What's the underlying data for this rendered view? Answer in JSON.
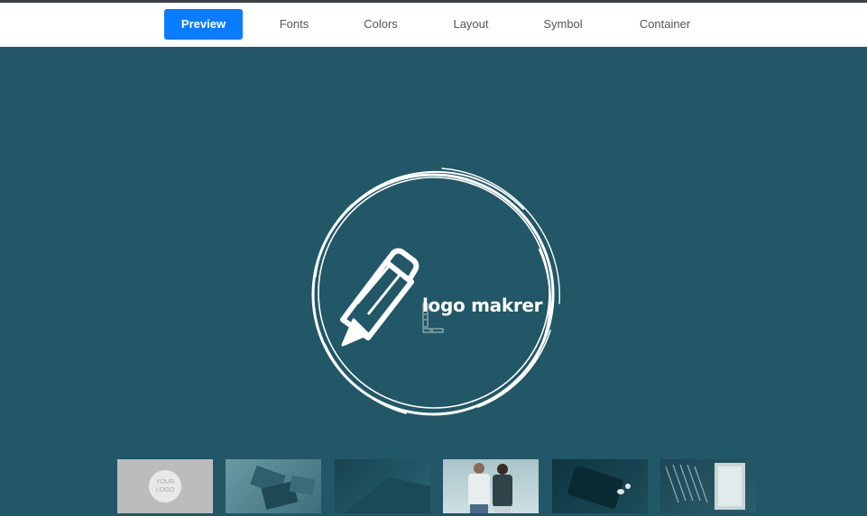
{
  "nav": {
    "tabs": [
      {
        "label": "Preview",
        "active": true
      },
      {
        "label": "Fonts",
        "active": false
      },
      {
        "label": "Colors",
        "active": false
      },
      {
        "label": "Layout",
        "active": false
      },
      {
        "label": "Symbol",
        "active": false
      },
      {
        "label": "Container",
        "active": false
      }
    ]
  },
  "preview": {
    "background_color": "#215766",
    "brand_name": "logo makrer",
    "symbol": "pencil-icon",
    "container": "brush-circle"
  },
  "mockups": {
    "items": [
      {
        "name": "mockup-card",
        "text_line1": "YOUR",
        "text_line2": "LOGO"
      },
      {
        "name": "mockup-business-cards"
      },
      {
        "name": "mockup-paper"
      },
      {
        "name": "mockup-tshirts"
      },
      {
        "name": "mockup-phone"
      },
      {
        "name": "mockup-shelf"
      }
    ]
  }
}
